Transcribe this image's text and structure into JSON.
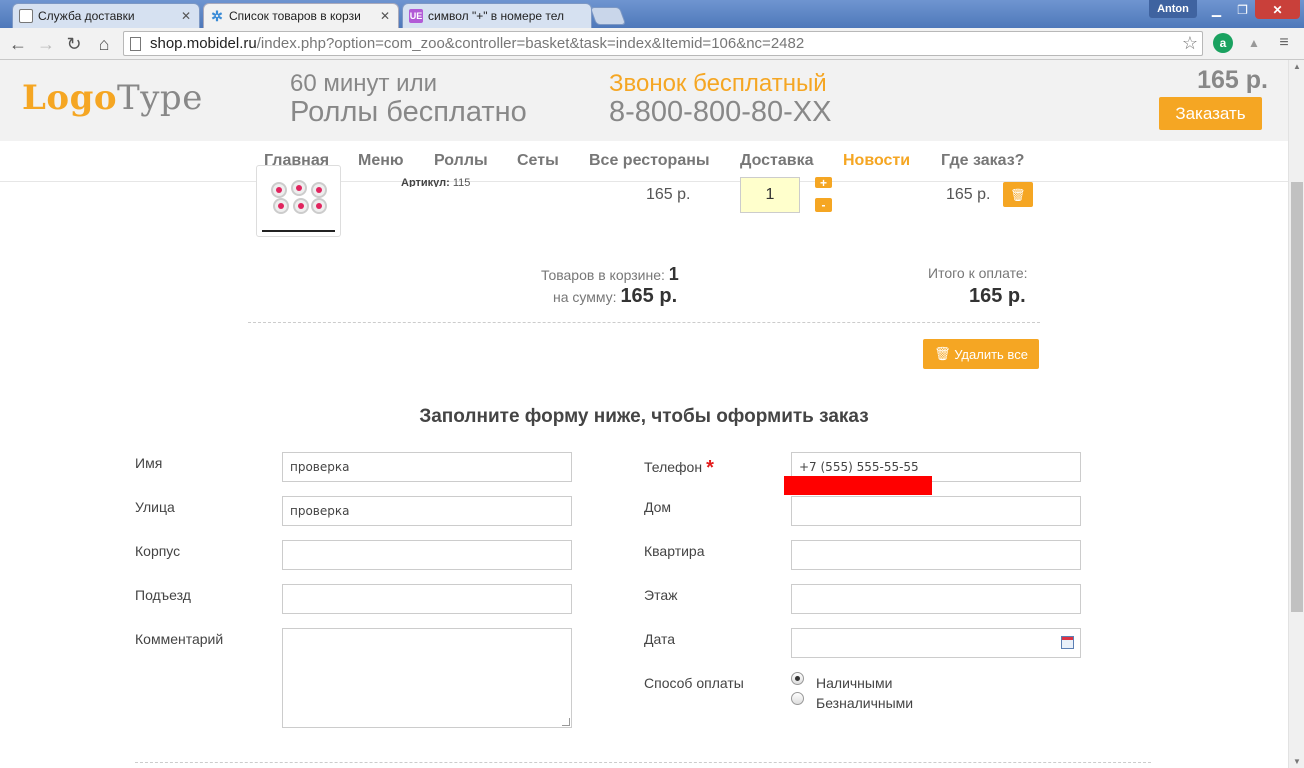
{
  "browser": {
    "tabs": [
      {
        "title": "Служба доставки",
        "icon": "page-icon"
      },
      {
        "title": "Список товаров в корзи",
        "icon": "gear-icon"
      },
      {
        "title": "символ \"+\" в номере тел",
        "icon": "ue-icon"
      }
    ],
    "user": "Anton",
    "url_scheme": "shop.mobidel.ru",
    "url_rest": "/index.php?option=com_zoo&controller=basket&task=index&Itemid=106&nc=2482"
  },
  "header": {
    "logo_part1": "Logo",
    "logo_part2": "Type",
    "promo_line1": "60 минут или",
    "promo_line2": "Роллы бесплатно",
    "phone_line1": "Звонок бесплатный",
    "phone_line2": "8-800-800-80-XX",
    "basket_sum": "165 р.",
    "order_label": "Заказать",
    "accent_color": "#f5a623"
  },
  "nav": {
    "items": [
      "Главная",
      "Меню",
      "Роллы",
      "Сеты",
      "Все рестораны",
      "Доставка",
      "Новости",
      "Где заказ?"
    ],
    "active": "Новости"
  },
  "basket": {
    "article_label": "Артикул:",
    "article_value": "115",
    "price": "165 р.",
    "quantity": "1",
    "plus": "+",
    "minus": "-",
    "row_total": "165 р.",
    "items_label": "Товаров в корзине:",
    "items_count": "1",
    "sum_label": "на сумму:",
    "sum_value": "165 р.",
    "total_label": "Итого к оплате:",
    "total_value": "165 р.",
    "clear_label": "Удалить все"
  },
  "form": {
    "title": "Заполните форму ниже, чтобы оформить заказ",
    "name_label": "Имя",
    "name_value": "проверка",
    "street_label": "Улица",
    "street_value": "проверка",
    "building_label": "Корпус",
    "building_value": "",
    "entrance_label": "Подъезд",
    "entrance_value": "",
    "comment_label": "Комментарий",
    "phone_label": "Телефон",
    "phone_required": "*",
    "phone_value": "+7 (555) 555-55-55",
    "house_label": "Дом",
    "house_value": "",
    "flat_label": "Квартира",
    "flat_value": "",
    "floor_label": "Этаж",
    "floor_value": "",
    "date_label": "Дата",
    "date_value": "",
    "payment_label": "Способ оплаты",
    "payment_options": [
      "Наличными",
      "Безналичными"
    ],
    "payment_selected": "Наличными"
  }
}
